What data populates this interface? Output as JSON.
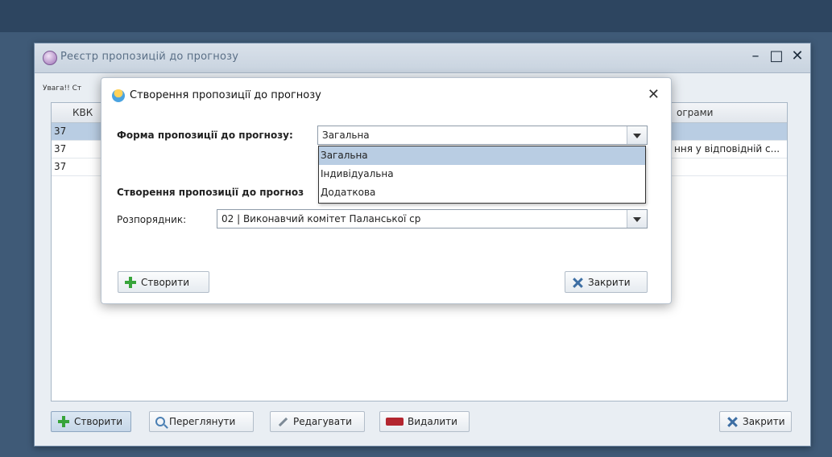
{
  "main_window": {
    "title": "Реєстр пропозицій до прогнозу",
    "small_label": "Увага!! Ст",
    "controls": [
      "–",
      "□",
      "✕"
    ],
    "table": {
      "col_kbk": "КВК",
      "col_program": "ограми",
      "rows": [
        {
          "kbk": "37",
          "program": ""
        },
        {
          "kbk": "37",
          "program": "ння у відповідній с..."
        },
        {
          "kbk": "37",
          "program": ""
        }
      ]
    },
    "buttons": {
      "create": "Створити",
      "view": "Переглянути",
      "edit": "Редагувати",
      "delete": "Видалити",
      "close": "Закрити"
    }
  },
  "dialog": {
    "title": "Створення пропозиції до прогнозу",
    "close_glyph": "✕",
    "form_label": "Форма пропозиції до прогнозу:",
    "form_value": "Загальна",
    "section_label": "Створення пропозиції до прогноз",
    "manager_label": "Розпорядник:",
    "manager_value": "02 | Виконавчий комітет Паланської ср",
    "buttons": {
      "create": "Створити",
      "close": "Закрити"
    }
  },
  "dropdown": {
    "options": [
      "Загальна",
      "Індивідуальна",
      "Додаткова"
    ],
    "selected": "Загальна"
  },
  "colors": {
    "desktop": "#3f5a77",
    "selection": "#b9cde3",
    "create_icon": "#37a43a",
    "delete_icon": "#b3262f"
  }
}
